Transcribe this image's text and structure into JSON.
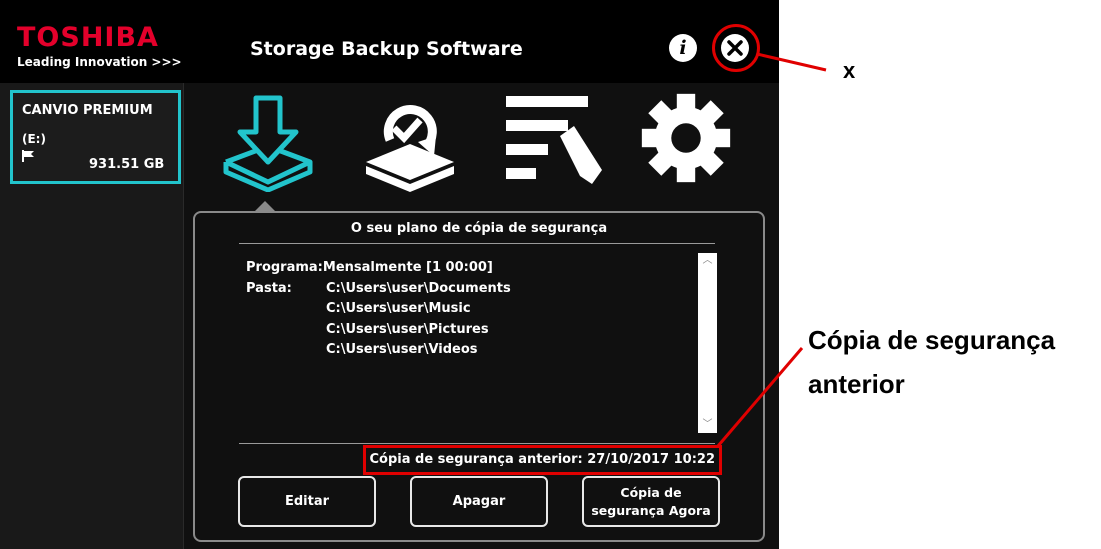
{
  "header": {
    "brand": "TOSHIBA",
    "tagline": "Leading Innovation >>>",
    "title": "Storage Backup Software",
    "info_label": "i"
  },
  "sidebar": {
    "drive": {
      "name": "CANVIO PREMIUM",
      "letter": "(E:)",
      "size": "931.51 GB"
    }
  },
  "nav": {
    "icons": [
      "backup-plan-icon",
      "restore-icon",
      "log-edit-icon",
      "settings-gear-icon"
    ],
    "selected": "backup-plan-icon",
    "accent_color": "#22c4cc"
  },
  "panel": {
    "title": "O seu plano de cópia de segurança",
    "schedule_label": "Programa:",
    "schedule_value": "Mensalmente [1 00:00]",
    "folder_label": "Pasta:",
    "folders": [
      "C:\\Users\\user\\Documents",
      "C:\\Users\\user\\Music",
      "C:\\Users\\user\\Pictures",
      "C:\\Users\\user\\Videos"
    ],
    "last_backup": "Cópia de segurança anterior: 27/10/2017 10:22"
  },
  "buttons": {
    "edit": "Editar",
    "delete": "Apagar",
    "backup_now": "Cópia de segurança Agora"
  },
  "annotations": {
    "close_label": "x",
    "last_backup_line1": "Cópia de segurança",
    "last_backup_line2": "anterior",
    "highlight_color": "#e00000"
  }
}
